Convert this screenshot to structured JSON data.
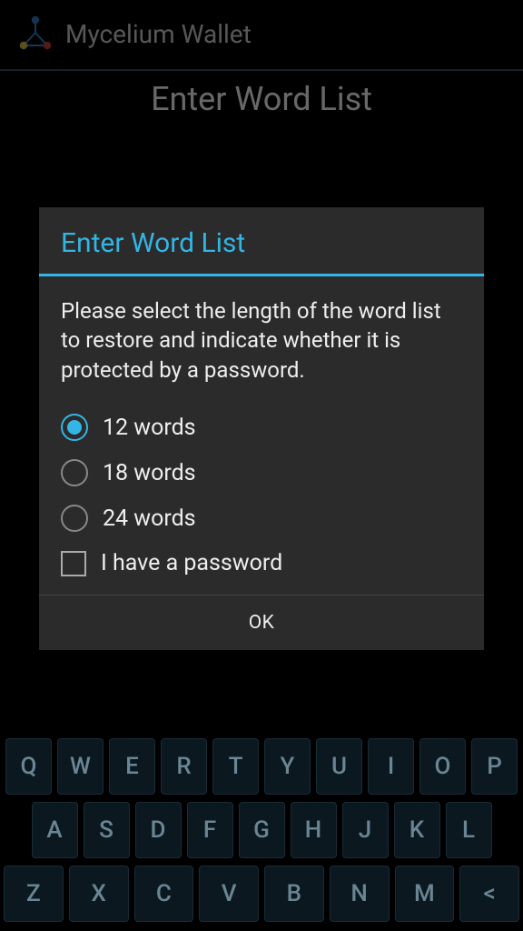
{
  "appbar": {
    "title": "Mycelium Wallet"
  },
  "page": {
    "title": "Enter Word List"
  },
  "dialog": {
    "title": "Enter Word List",
    "description": "Please select the length of the word list to restore and indicate whether it is protected by a password.",
    "options": {
      "o12": {
        "label": "12 words",
        "selected": true
      },
      "o18": {
        "label": "18 words",
        "selected": false
      },
      "o24": {
        "label": "24 words",
        "selected": false
      }
    },
    "password": {
      "label": "I have a password",
      "checked": false
    },
    "ok": "OK"
  },
  "keyboard": {
    "row1": [
      "Q",
      "W",
      "E",
      "R",
      "T",
      "Y",
      "U",
      "I",
      "O",
      "P"
    ],
    "row2": [
      "A",
      "S",
      "D",
      "F",
      "G",
      "H",
      "J",
      "K",
      "L"
    ],
    "row3": [
      "Z",
      "X",
      "C",
      "V",
      "B",
      "N",
      "M",
      "<"
    ]
  }
}
